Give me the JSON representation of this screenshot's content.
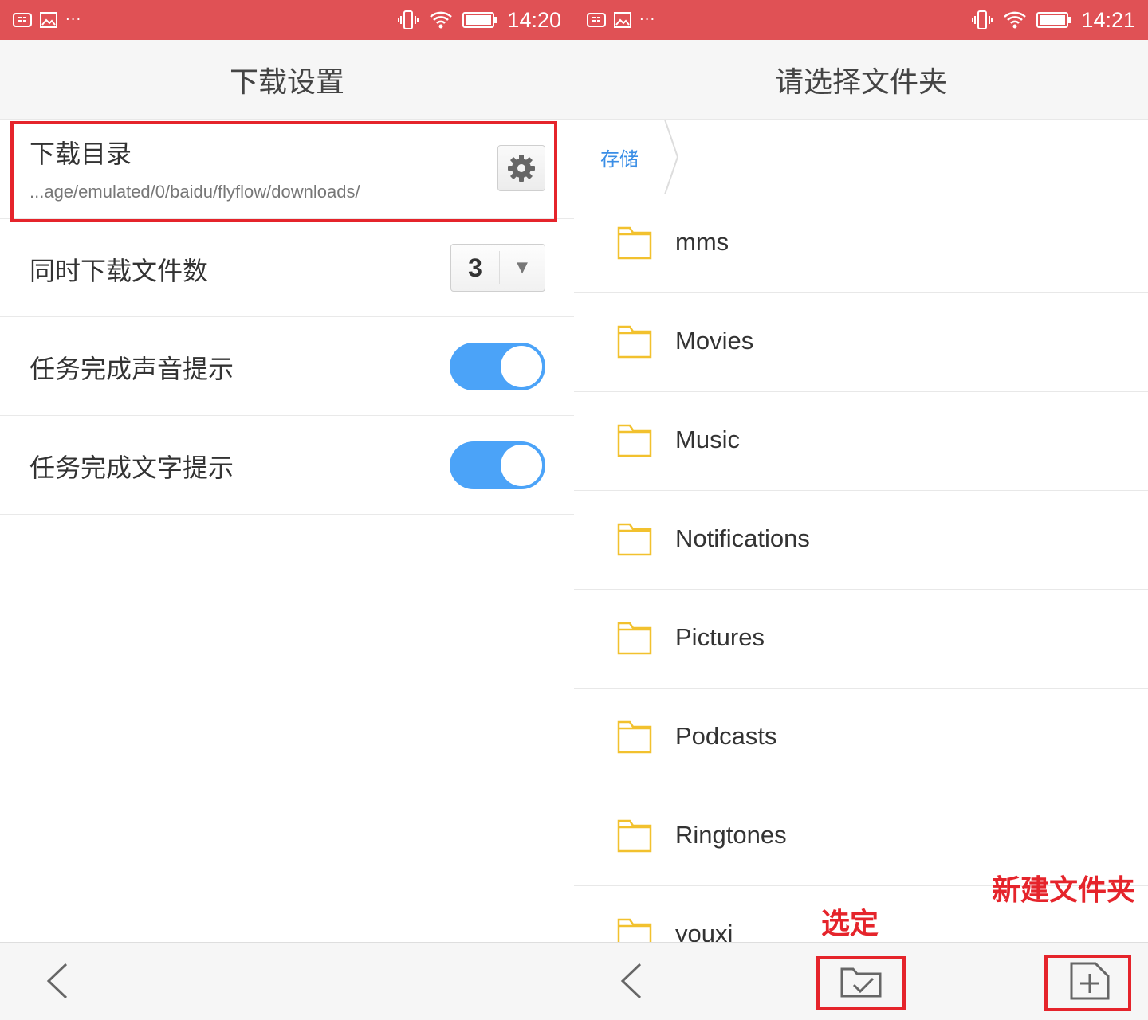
{
  "left_screen": {
    "status": {
      "time": "14:20",
      "overflow": "···"
    },
    "title": "下载设置",
    "download_dir": {
      "label": "下载目录",
      "path": "...age/emulated/0/baidu/flyflow/downloads/",
      "settings_icon": "gear-icon"
    },
    "concurrent": {
      "label": "同时下载文件数",
      "value": "3",
      "arrow": "▼"
    },
    "sound_notice": {
      "label": "任务完成声音提示",
      "on": true
    },
    "text_notice": {
      "label": "任务完成文字提示",
      "on": true
    },
    "nav": {
      "back_icon": "chevron-left-icon"
    }
  },
  "right_screen": {
    "status": {
      "time": "14:21",
      "overflow": "···"
    },
    "title": "请选择文件夹",
    "breadcrumb": "存储",
    "folders": [
      {
        "name": "mms"
      },
      {
        "name": "Movies"
      },
      {
        "name": "Music"
      },
      {
        "name": "Notifications"
      },
      {
        "name": "Pictures"
      },
      {
        "name": "Podcasts"
      },
      {
        "name": "Ringtones"
      },
      {
        "name": "youxi"
      }
    ],
    "annotations": {
      "select": "选定",
      "new_folder": "新建文件夹"
    },
    "nav": {
      "back_icon": "chevron-left-icon",
      "select_icon": "folder-check-icon",
      "new_folder_icon": "folder-plus-icon"
    }
  },
  "colors": {
    "status_bar": "#e05155",
    "toggle_on": "#4ba3f8",
    "highlight": "#e5242b",
    "breadcrumb": "#3a8ee6",
    "folder_icon": "#f2c12e"
  }
}
